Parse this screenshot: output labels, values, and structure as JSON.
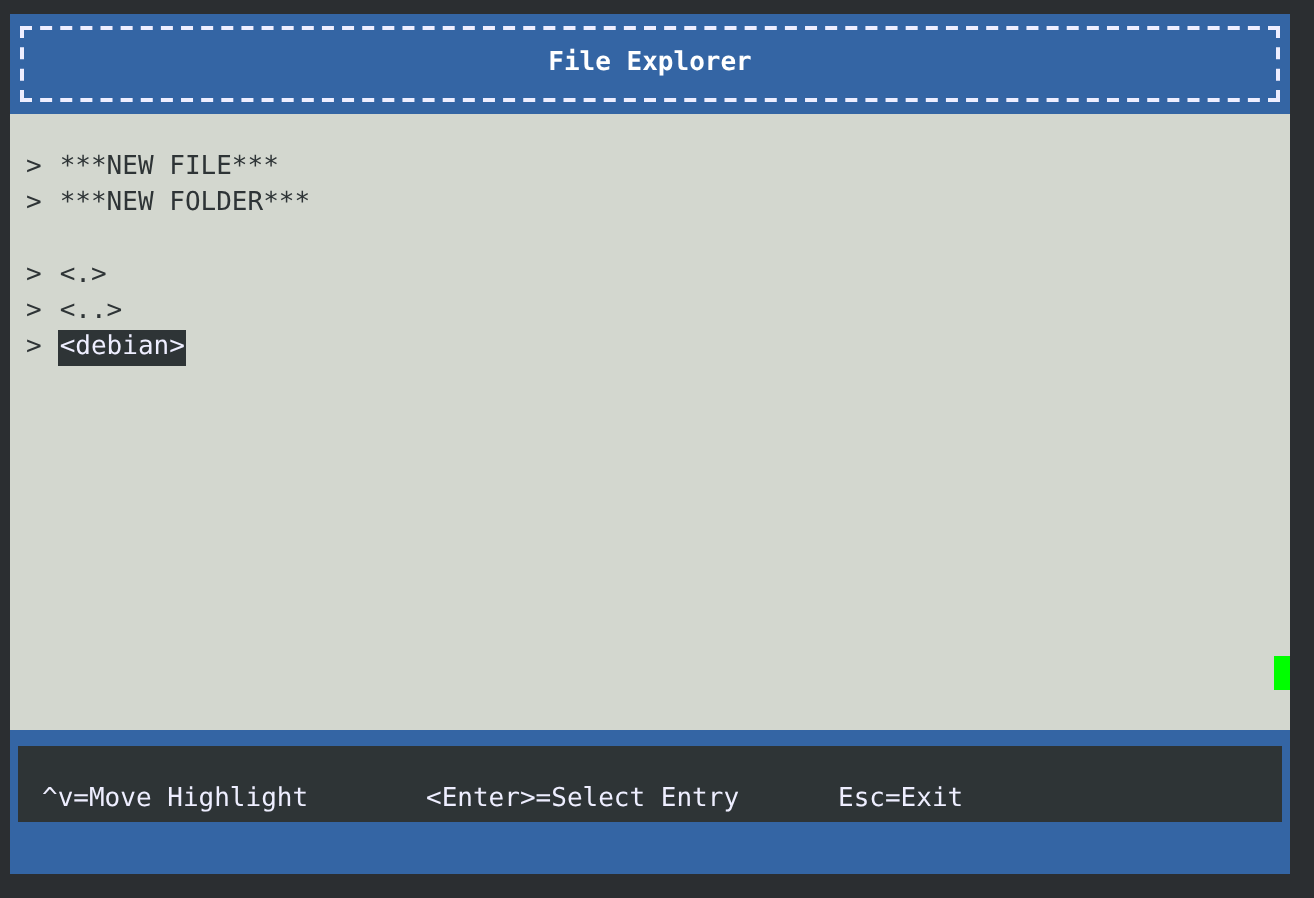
{
  "window": {
    "title": "File Explorer"
  },
  "groups": [
    {
      "entries": [
        {
          "marker": ">",
          "label": "***NEW FILE***",
          "selected": false
        },
        {
          "marker": ">",
          "label": "***NEW FOLDER***",
          "selected": false
        }
      ]
    },
    {
      "entries": [
        {
          "marker": ">",
          "label": "<.>",
          "selected": false
        },
        {
          "marker": ">",
          "label": "<..>",
          "selected": false
        },
        {
          "marker": ">",
          "label": "<debian>",
          "selected": true
        }
      ]
    }
  ],
  "status_bar": {
    "hints": [
      "^v=Move Highlight",
      "<Enter>=Select Entry",
      "Esc=Exit"
    ]
  }
}
